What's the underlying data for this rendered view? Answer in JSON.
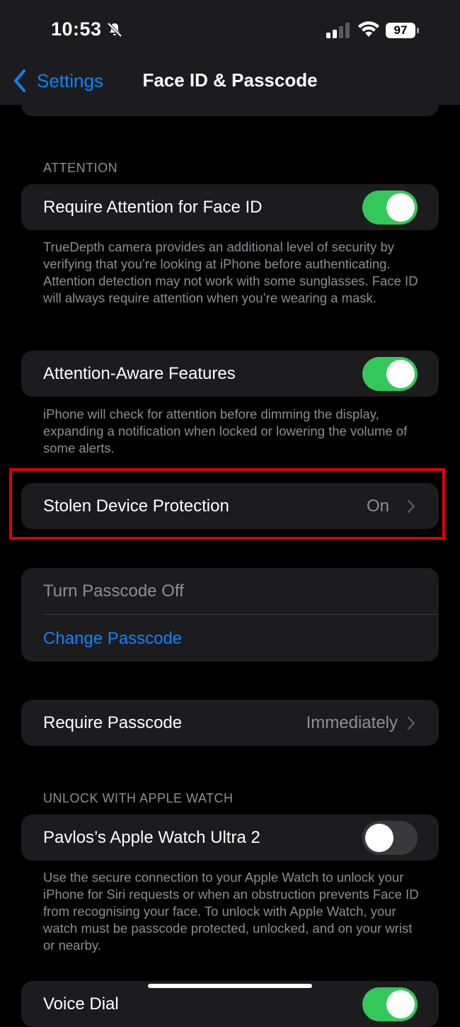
{
  "status": {
    "time": "10:53",
    "battery": "97"
  },
  "nav": {
    "back_label": "Settings",
    "title": "Face ID & Passcode"
  },
  "attention": {
    "header": "ATTENTION",
    "require_label": "Require Attention for Face ID",
    "require_on": true,
    "require_note": "TrueDepth camera provides an additional level of security by verifying that you’re looking at iPhone before authenticating. Attention detection may not work with some sunglasses. Face ID will always require attention when you’re wearing a mask.",
    "aware_label": "Attention-Aware Features",
    "aware_on": true,
    "aware_note": "iPhone will check for attention before dimming the display, expanding a notification when locked or lowering the volume of some alerts."
  },
  "stolen": {
    "label": "Stolen Device Protection",
    "value": "On"
  },
  "passcode": {
    "turn_off_label": "Turn Passcode Off",
    "change_label": "Change Passcode",
    "require_label": "Require Passcode",
    "require_value": "Immediately"
  },
  "watch": {
    "header": "UNLOCK WITH APPLE WATCH",
    "device_label": "Pavlos’s Apple Watch Ultra 2",
    "device_on": false,
    "note": "Use the secure connection to your Apple Watch to unlock your iPhone for Siri requests or when an obstruction prevents Face ID from recognising your face. To unlock with Apple Watch, your watch must be passcode protected, unlocked, and on your wrist or nearby."
  },
  "partial_row": {
    "label": "Voice Dial",
    "on": true
  },
  "colors": {
    "accent": "#0a84ff",
    "toggle_on": "#34c759",
    "highlight": "#e00000"
  }
}
